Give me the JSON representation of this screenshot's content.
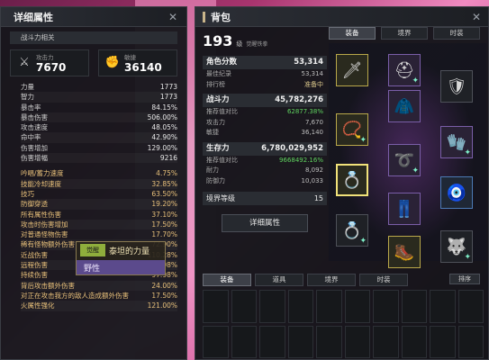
{
  "attr_panel": {
    "title": "详细属性",
    "section": "战斗力相关",
    "attack": {
      "label": "攻击力",
      "value": "7670"
    },
    "agility": {
      "label": "敏捷",
      "value": "36140"
    },
    "stats": [
      {
        "k": "力量",
        "v": "1773"
      },
      {
        "k": "智力",
        "v": "1773"
      },
      {
        "k": "暴击率",
        "v": "84.15%"
      },
      {
        "k": "暴击伤害",
        "v": "506.00%"
      },
      {
        "k": "攻击速度",
        "v": "48.05%"
      },
      {
        "k": "命中率",
        "v": "42.90%"
      },
      {
        "k": "伤害增加",
        "v": "129.00%"
      },
      {
        "k": "伤害增幅",
        "v": "9216"
      }
    ],
    "skills": [
      {
        "k": "吟唱/蓄力速度",
        "v": "4.75%"
      },
      {
        "k": "技能冷却速度",
        "v": "32.85%"
      },
      {
        "k": "技巧",
        "v": "63.50%"
      },
      {
        "k": "防御穿透",
        "v": "19.20%"
      },
      {
        "k": "所有属性伤害",
        "v": "37.10%"
      },
      {
        "k": "攻击时伤害增加",
        "v": "17.50%"
      },
      {
        "k": "对普通怪物伤害",
        "v": "17.70%"
      },
      {
        "k": "稀有怪物额外伤害",
        "v": "72.90%"
      },
      {
        "k": "近战伤害",
        "v": "110.28%"
      },
      {
        "k": "远程伤害",
        "v": "92.98%"
      },
      {
        "k": "持续伤害",
        "v": "97.98%"
      },
      {
        "k": "背后攻击额外伤害",
        "v": "24.00%"
      },
      {
        "k": "对正在攻击我方的敌人造成额外伤害",
        "v": "17.50%"
      },
      {
        "k": "火属性强化",
        "v": "121.00%"
      }
    ]
  },
  "tooltip": {
    "badge": "觉醒",
    "line1": "泰坦的力量",
    "line2": "野性"
  },
  "bag_panel": {
    "title": "背包",
    "level": "193",
    "level_unit": "级",
    "level_tag": "觉醒铁拳",
    "role_score": {
      "label": "角色分数",
      "value": "53,314"
    },
    "best_record": {
      "label": "最佳纪录",
      "value": "53,314"
    },
    "rank": {
      "label": "排行榜",
      "value": "准备中"
    },
    "combat": {
      "label": "战斗力",
      "value": "45,782,276"
    },
    "combat_rows": [
      {
        "k": "推荐值对比",
        "v": "62877.38%",
        "style": "green"
      },
      {
        "k": "攻击力",
        "v": "7,670",
        "style": ""
      },
      {
        "k": "敏捷",
        "v": "36,140",
        "style": ""
      }
    ],
    "survival": {
      "label": "生存力",
      "value": "6,780,029,952"
    },
    "survival_rows": [
      {
        "k": "推荐值对比",
        "v": "9668492.16%",
        "style": "green"
      },
      {
        "k": "耐力",
        "v": "8,092",
        "style": ""
      },
      {
        "k": "防御力",
        "v": "10,033",
        "style": ""
      }
    ],
    "realm": {
      "label": "境界等级",
      "value": "15"
    },
    "detail_button": "详细属性",
    "equip_tabs": [
      "装备",
      "境界",
      "时装"
    ],
    "inv_tabs": [
      "装备",
      "道具",
      "境界",
      "时装"
    ],
    "sort_label": "排序"
  },
  "slot_icons": [
    "weapon-icon",
    "helmet-icon",
    "shoulder-icon",
    "necklace-icon",
    "chest-icon",
    "glove-icon",
    "ring-icon",
    "belt-icon",
    "earring-icon",
    "ring2-icon",
    "pants-icon",
    "pet-icon",
    "ring3-icon",
    "boots-icon"
  ],
  "colors": {
    "accent_gold": "#e8c07a",
    "green": "#5fd35f",
    "panel_bg": "#14161a"
  }
}
